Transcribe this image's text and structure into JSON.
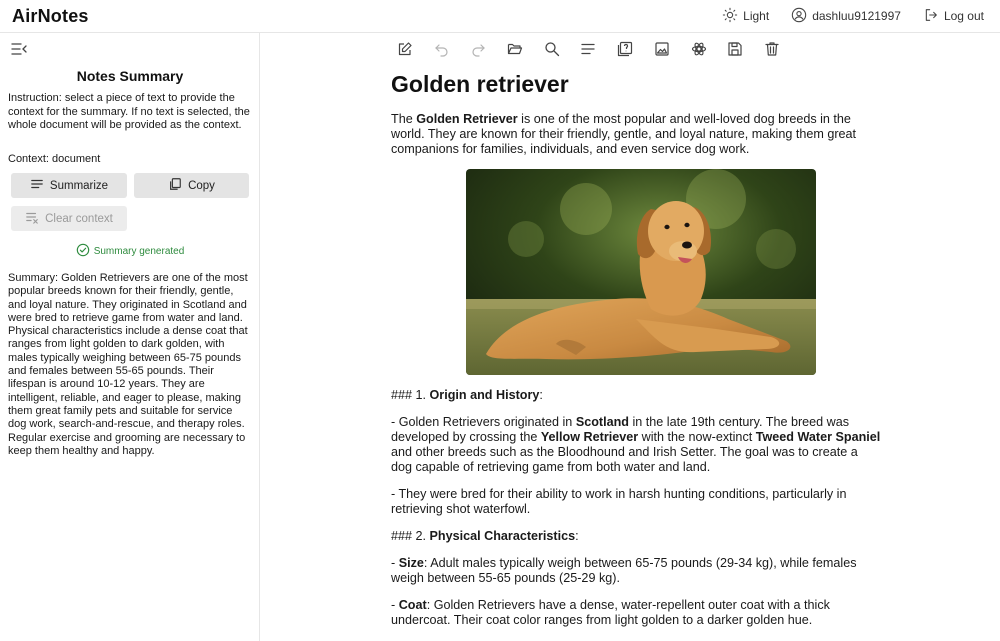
{
  "app": {
    "brand": "AirNotes",
    "theme_label": "Light",
    "username": "dashluu9121997",
    "logout_label": "Log out"
  },
  "sidebar": {
    "title": "Notes Summary",
    "instruction": "Instruction: select a piece of text to provide the context for the summary. If no text is selected, the whole document will be provided as the context.",
    "context_line": "Context: document",
    "summarize_label": "Summarize",
    "copy_label": "Copy",
    "clear_label": "Clear context",
    "status_text": "Summary generated",
    "summary_text": "Summary: Golden Retrievers are one of the most popular breeds known for their friendly, gentle, and loyal nature. They originated in Scotland and were bred to retrieve game from water and land. Physical characteristics include a dense coat that ranges from light golden to dark golden, with males typically weighing between 65-75 pounds and females between 55-65 pounds. Their lifespan is around 10-12 years. They are intelligent, reliable, and eager to please, making them great family pets and suitable for service dog work, search-and-rescue, and therapy roles. Regular exercise and grooming are necessary to keep them healthy and happy."
  },
  "toolbar": {
    "icons": [
      "edit-icon",
      "undo-icon",
      "redo-icon",
      "open-folder-icon",
      "search-icon",
      "text-align-icon",
      "summary-icon",
      "image-icon",
      "settings-icon",
      "save-icon",
      "delete-icon"
    ]
  },
  "doc": {
    "title": "Golden retriever",
    "intro": {
      "pre": "The ",
      "bold": "Golden Retriever",
      "post": " is one of the most popular and well-loved dog breeds in the world. They are known for their friendly, gentle, and loyal nature, making them great companions for families, individuals, and even service dog work."
    },
    "section1": {
      "pre": "### 1. ",
      "bold": "Origin and History",
      "post": ":"
    },
    "origin_bullet1": {
      "t1": "- Golden Retrievers originated in ",
      "b1": "Scotland",
      "t2": " in the late 19th century. The breed was developed by crossing the ",
      "b2": "Yellow Retriever",
      "t3": " with the now-extinct ",
      "b3": "Tweed Water Spaniel",
      "t4": " and other breeds such as the Bloodhound and Irish Setter. The goal was to create a dog capable of retrieving game from both water and land."
    },
    "origin_bullet2": "- They were bred for their ability to work in harsh hunting conditions, particularly in retrieving shot waterfowl.",
    "section2": {
      "pre": "### 2. ",
      "bold": "Physical Characteristics",
      "post": ":"
    },
    "size_bullet": {
      "pre": "- ",
      "bold": "Size",
      "post": ": Adult males typically weigh between 65-75 pounds (29-34 kg), while females weigh between 55-65 pounds (25-29 kg)."
    },
    "coat_bullet": {
      "pre": "- ",
      "bold": "Coat",
      "post": ": Golden Retrievers have a dense, water-repellent outer coat with a thick undercoat. Their coat color ranges from light golden to a darker golden hue."
    }
  },
  "colors": {
    "accent_green": "#2e8b3e",
    "button_bg": "#e4e4e4",
    "border": "#e6e6e6"
  }
}
